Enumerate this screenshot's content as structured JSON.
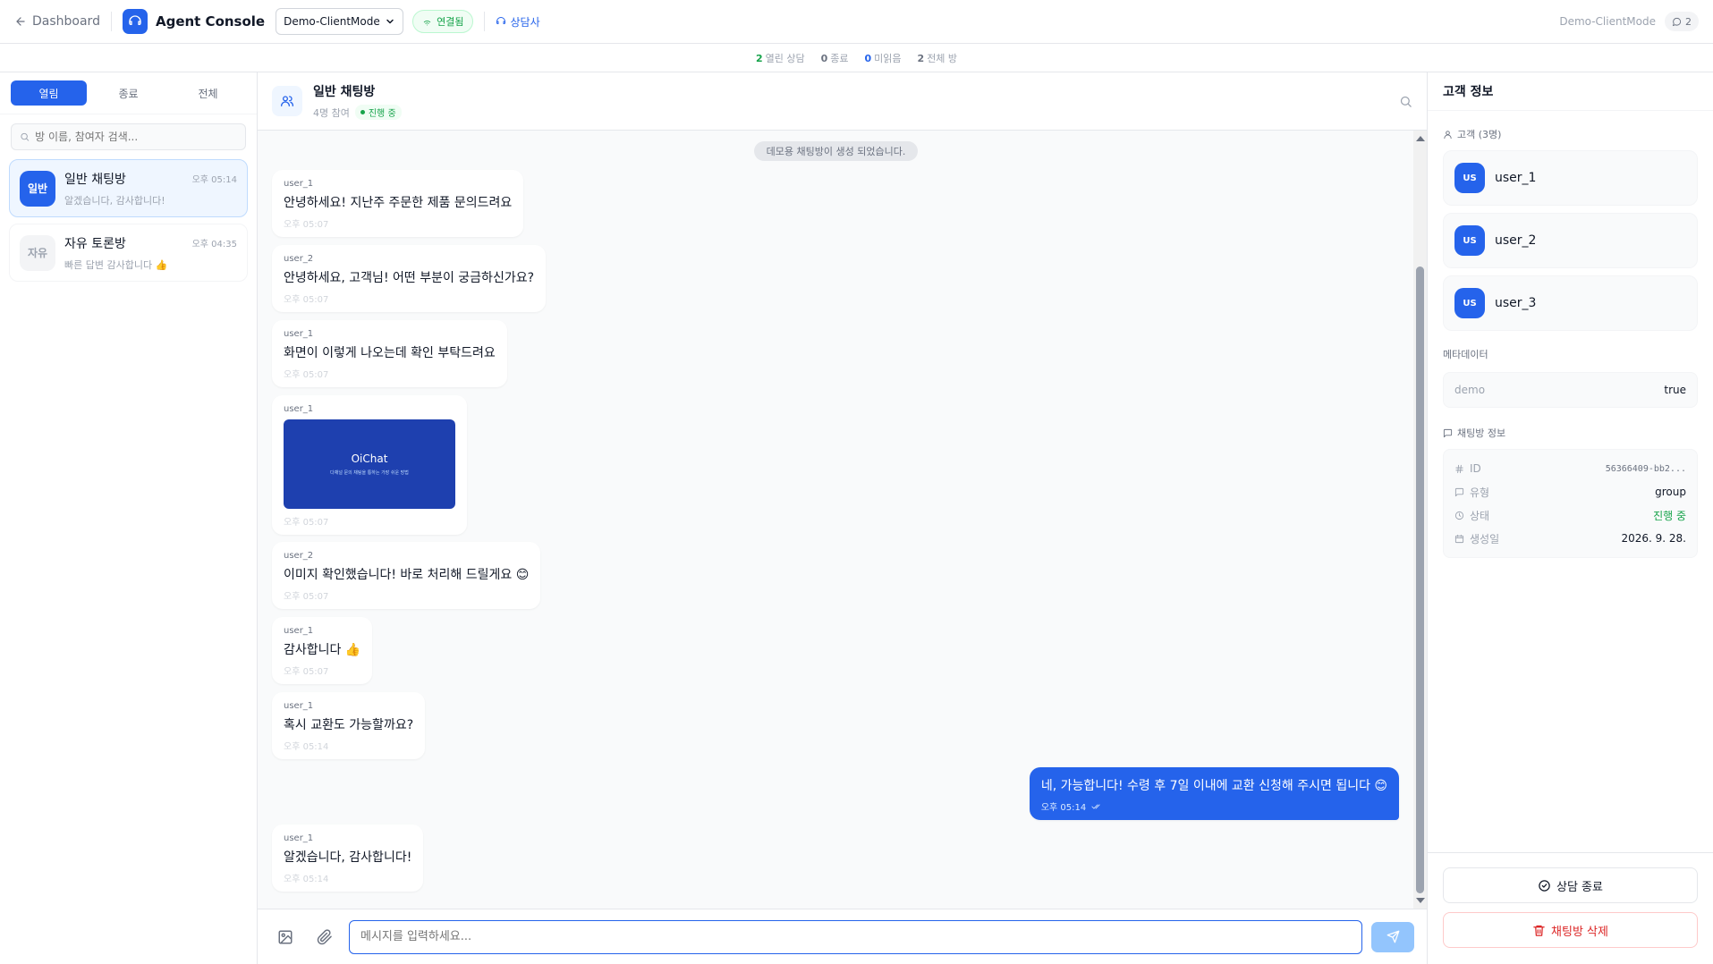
{
  "topbar": {
    "back_label": "Dashboard",
    "app_title": "Agent Console",
    "mode_select_value": "Demo-ClientMode",
    "connection_label": "연결됨",
    "agent_label": "상담사",
    "right_mode_label": "Demo-ClientMode",
    "chat_count": "2"
  },
  "stats": [
    {
      "value": "2",
      "label": "열린 상담",
      "color": "#16a34a"
    },
    {
      "value": "0",
      "label": "종료",
      "color": "#6b7280"
    },
    {
      "value": "0",
      "label": "미읽음",
      "color": "#2563eb"
    },
    {
      "value": "2",
      "label": "전체 방",
      "color": "#6b7280"
    }
  ],
  "sidebar": {
    "tabs": [
      {
        "label": "열림",
        "active": true
      },
      {
        "label": "종료",
        "active": false
      },
      {
        "label": "전체",
        "active": false
      }
    ],
    "search_placeholder": "방 이름, 참여자 검색...",
    "rooms": [
      {
        "avatar": "일반",
        "name": "일반 채팅방",
        "time": "오후 05:14",
        "last_message": "알겠습니다, 감사합니다!",
        "active": true
      },
      {
        "avatar": "자유",
        "name": "자유 토론방",
        "time": "오후 04:35",
        "last_message": "빠른 답변 감사합니다 👍",
        "active": false
      }
    ]
  },
  "chat": {
    "title": "일반 채팅방",
    "participants": "4명 참여",
    "status_badge": "진행 중",
    "system_message": "데모용 채팅방이 생성 되었습니다.",
    "messages": [
      {
        "user": "user_1",
        "text": "안녕하세요! 지난주 주문한 제품 문의드려요",
        "time": "오후 05:07"
      },
      {
        "user": "user_2",
        "text": "안녕하세요, 고객님! 어떤 부분이 궁금하신가요?",
        "time": "오후 05:07"
      },
      {
        "user": "user_1",
        "text": "화면이 이렇게 나오는데 확인 부탁드려요",
        "time": "오후 05:07"
      },
      {
        "user": "user_1",
        "image_title": "OiChat",
        "image_caption": "다채널 문의 채팅을 통하는 가장 쉬운 방법",
        "time": "오후 05:07"
      },
      {
        "user": "user_2",
        "text": "이미지 확인했습니다! 바로 처리해 드릴게요 😊",
        "time": "오후 05:07"
      },
      {
        "user": "user_1",
        "text": "감사합니다 👍",
        "time": "오후 05:07"
      },
      {
        "user": "user_1",
        "text": "혹시 교환도 가능할까요?",
        "time": "오후 05:14"
      },
      {
        "mine": true,
        "text": "네, 가능합니다! 수령 후 7일 이내에 교환 신청해 주시면 됩니다 😊",
        "time": "오후 05:14"
      },
      {
        "user": "user_1",
        "text": "알겠습니다, 감사합니다!",
        "time": "오후 05:14"
      }
    ],
    "input_placeholder": "메시지를 입력하세요..."
  },
  "customer_panel": {
    "title": "고객 정보",
    "customers_label": "고객 (3명)",
    "customers": [
      {
        "initials": "US",
        "name": "user_1"
      },
      {
        "initials": "US",
        "name": "user_2"
      },
      {
        "initials": "US",
        "name": "user_3"
      }
    ],
    "metadata_label": "메타데이터",
    "metadata": {
      "key": "demo",
      "value": "true"
    },
    "room_info_label": "채팅방 정보",
    "room_info": [
      {
        "icon": "hash-icon",
        "key": "ID",
        "value": "56366409-bb2..."
      },
      {
        "icon": "chat-icon",
        "key": "유형",
        "value": "group"
      },
      {
        "icon": "clock-icon",
        "key": "상태",
        "value": "진행 중"
      },
      {
        "icon": "calendar-icon",
        "key": "생성일",
        "value": "2026. 9. 28."
      }
    ],
    "end_button": "상담 종료",
    "delete_button": "채팅방 삭제"
  }
}
